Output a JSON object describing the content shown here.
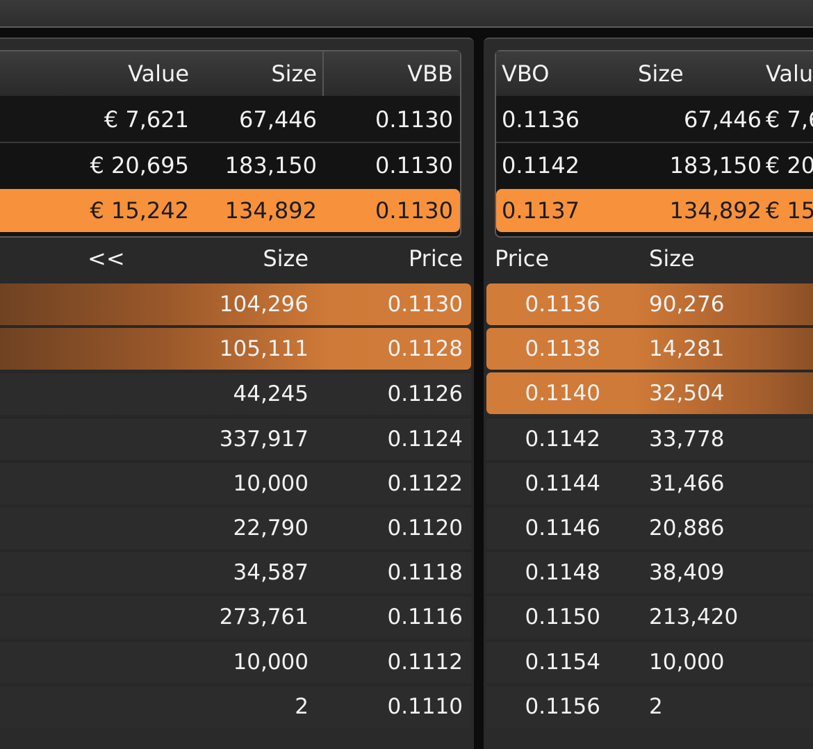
{
  "bid_summary": {
    "headers": [
      "Value",
      "Size",
      "VBB"
    ],
    "rows": [
      {
        "value": "€ 7,621",
        "size": "67,446",
        "price": "0.1130"
      },
      {
        "value": "€ 20,695",
        "size": "183,150",
        "price": "0.1130"
      },
      {
        "value": "€ 15,242",
        "size": "134,892",
        "price": "0.1130"
      }
    ]
  },
  "ask_summary": {
    "headers": [
      "VBO",
      "Size",
      "Valu"
    ],
    "rows": [
      {
        "price": "0.1136",
        "size": "67,446",
        "value": "€ 7,6"
      },
      {
        "price": "0.1142",
        "size": "183,150",
        "value": "€ 20"
      },
      {
        "price": "0.1137",
        "size": "134,892",
        "value": "€ 15"
      }
    ]
  },
  "bid_book": {
    "collapse_label": "<<",
    "headers": [
      "Size",
      "Price"
    ],
    "rows": [
      {
        "size": "104,296",
        "price": "0.1130"
      },
      {
        "size": "105,111",
        "price": "0.1128"
      },
      {
        "size": "44,245",
        "price": "0.1126"
      },
      {
        "size": "337,917",
        "price": "0.1124"
      },
      {
        "size": "10,000",
        "price": "0.1122"
      },
      {
        "size": "22,790",
        "price": "0.1120"
      },
      {
        "size": "34,587",
        "price": "0.1118"
      },
      {
        "size": "273,761",
        "price": "0.1116"
      },
      {
        "size": "10,000",
        "price": "0.1112"
      },
      {
        "size": "2",
        "price": "0.1110"
      }
    ]
  },
  "ask_book": {
    "headers": [
      "Price",
      "Size"
    ],
    "rows": [
      {
        "price": "0.1136",
        "size": "90,276"
      },
      {
        "price": "0.1138",
        "size": "14,281"
      },
      {
        "price": "0.1140",
        "size": "32,504"
      },
      {
        "price": "0.1142",
        "size": "33,778"
      },
      {
        "price": "0.1144",
        "size": "31,466"
      },
      {
        "price": "0.1146",
        "size": "20,886"
      },
      {
        "price": "0.1148",
        "size": "38,409"
      },
      {
        "price": "0.1150",
        "size": "213,420"
      },
      {
        "price": "0.1154",
        "size": "10,000"
      },
      {
        "price": "0.1156",
        "size": "2"
      }
    ]
  },
  "colors": {
    "highlight": "#f7913b",
    "orange_row": "#d27c3a",
    "background": "#2b2b2b"
  }
}
